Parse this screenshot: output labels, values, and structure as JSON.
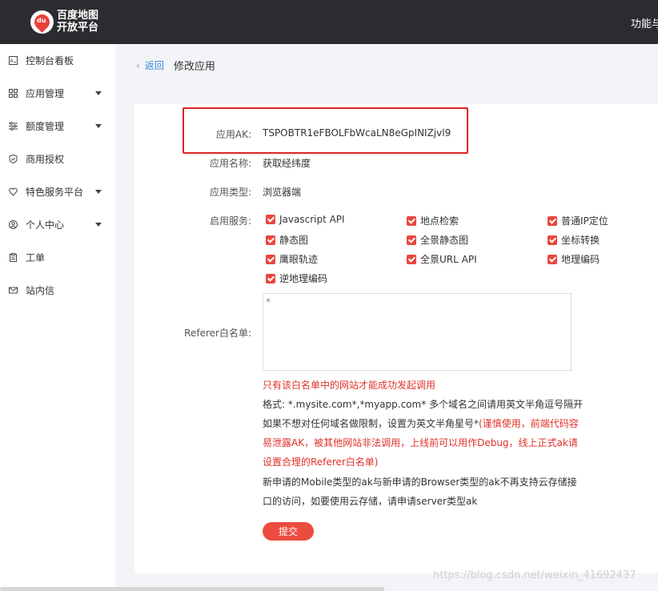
{
  "topbar": {
    "logo_du": "du",
    "logo_line1": "百度地图",
    "logo_line2": "开放平台",
    "right_text": "功能与"
  },
  "sidebar": {
    "items": [
      {
        "label": "控制台看板",
        "icon": "dashboard-icon",
        "has_caret": false
      },
      {
        "label": "应用管理",
        "icon": "grid-icon",
        "has_caret": true
      },
      {
        "label": "额度管理",
        "icon": "sliders-icon",
        "has_caret": true
      },
      {
        "label": "商用授权",
        "icon": "shield-icon",
        "has_caret": false
      },
      {
        "label": "特色服务平台",
        "icon": "heart-shield-icon",
        "has_caret": true
      },
      {
        "label": "个人中心",
        "icon": "user-circle-icon",
        "has_caret": true
      },
      {
        "label": "工单",
        "icon": "clipboard-icon",
        "has_caret": false
      },
      {
        "label": "站内信",
        "icon": "mail-icon",
        "has_caret": false
      }
    ]
  },
  "breadcrumb": {
    "back_chevron": "‹",
    "back": "返回",
    "title": "修改应用"
  },
  "form": {
    "ak_label": "应用AK:",
    "ak_value": "TSPOBTR1eFBOLFbWcaLN8eGpINIZjvl9",
    "name_label": "应用名称:",
    "name_value": "获取经纬度",
    "type_label": "应用类型:",
    "type_value": "浏览器端",
    "services_label": "启用服务:",
    "services": [
      "Javascript API",
      "地点检索",
      "普通IP定位",
      "静态图",
      "全景静态图",
      "坐标转换",
      "鹰眼轨迹",
      "全景URL API",
      "地理编码",
      "逆地理编码"
    ],
    "referer_label": "Referer白名单:",
    "referer_value": "*",
    "notes": {
      "warning": "只有该白名单中的网站才能成功发起调用",
      "format": "格式: *.mysite.com*,*myapp.com* 多个域名之间请用英文半角逗号隔开",
      "line3_gray": "如果不想对任何域名做限制，设置为英文半角星号*",
      "line3_red": "(谨慎使用，前端代码容",
      "line4": "易泄露AK，被其他网站非法调用，上线前可以用作Debug，线上正式ak请",
      "line5": "设置合理的Referer白名单)",
      "line6": "新申请的Mobile类型的ak与新申请的Browser类型的ak不再支持云存储接",
      "line7": "口的访问，如要使用云存储，请申请server类型ak"
    },
    "submit_label": "提交"
  },
  "watermark": "https://blog.csdn.net/weixin_41692437",
  "colors": {
    "accent": "#ec4c40",
    "link": "#3e88e2",
    "highlight_border": "#e02424",
    "topbar": "#2b2c30"
  }
}
